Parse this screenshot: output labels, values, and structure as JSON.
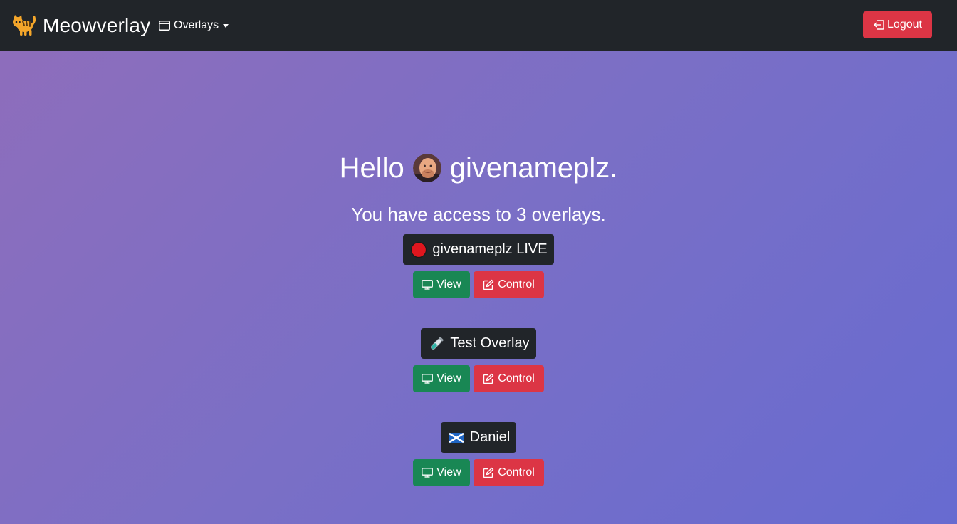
{
  "navbar": {
    "brand": "Meowverlay",
    "brand_icon": "cat-icon",
    "overlays_menu": "Overlays",
    "logout_label": "Logout"
  },
  "greeting": {
    "hello": "Hello",
    "username": "givenameplz."
  },
  "access_text": "You have access to 3 overlays.",
  "overlays": [
    {
      "name": "givenameplz LIVE",
      "icon": "red-circle-icon",
      "view_label": "View",
      "control_label": "Control"
    },
    {
      "name": "Test Overlay",
      "icon": "test-tube-icon",
      "view_label": "View",
      "control_label": "Control"
    },
    {
      "name": "Daniel",
      "icon": "scotland-flag-icon",
      "view_label": "View",
      "control_label": "Control"
    }
  ],
  "colors": {
    "navbar": "#212529",
    "danger": "#dc3545",
    "success": "#198754",
    "gradient_start": "#8f6dbb",
    "gradient_end": "#676bd0"
  }
}
